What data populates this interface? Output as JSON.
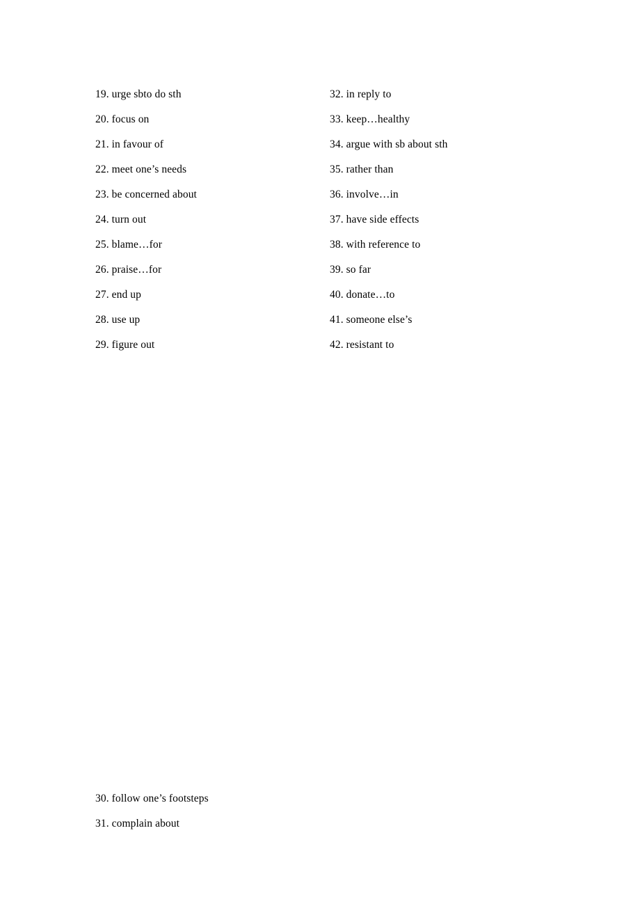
{
  "document": {
    "type": "phrase-list",
    "page_background": "#ffffff",
    "text_color": "#000000"
  },
  "columns": {
    "left": {
      "entries": [
        {
          "number": "19.",
          "text": "urge sbto do sth",
          "full": "19. urge sbto do sth"
        },
        {
          "number": "20.",
          "text": "focus on",
          "full": "20. focus on"
        },
        {
          "number": "21.",
          "text": "in favour of",
          "full": "21. in favour of"
        },
        {
          "number": "22.",
          "text": "meet one’s needs",
          "full": "22. meet one’s needs"
        },
        {
          "number": "23.",
          "text": "be concerned about",
          "full": "23. be concerned about"
        },
        {
          "number": "24.",
          "text": "turn out",
          "full": "24. turn out"
        },
        {
          "number": "25.",
          "text": "blame…for",
          "full": "25. blame…for"
        },
        {
          "number": "26.",
          "text": "praise…for",
          "full": "26. praise…for"
        },
        {
          "number": "27.",
          "text": "end up",
          "full": "27. end up"
        },
        {
          "number": "28.",
          "text": "use up",
          "full": "28. use up"
        },
        {
          "number": "29.",
          "text": "figure out",
          "full": "29. figure out"
        }
      ]
    },
    "right": {
      "entries": [
        {
          "number": "32.",
          "text": "in reply to",
          "full": "32. in reply to"
        },
        {
          "number": "33.",
          "text": "keep…healthy",
          "full": "33. keep…healthy"
        },
        {
          "number": "34.",
          "text": "argue with sb about sth",
          "full": "34. argue with sb about sth"
        },
        {
          "number": "35.",
          "text": "rather than",
          "full": "35. rather than"
        },
        {
          "number": "36.",
          "text": "involve…in",
          "full": "36. involve…in"
        },
        {
          "number": "37.",
          "text": "have side effects",
          "full": "37. have side effects"
        },
        {
          "number": "38.",
          "text": "with reference to",
          "full": "38. with reference to"
        },
        {
          "number": "39.",
          "text": "so far",
          "full": "39. so far"
        },
        {
          "number": "40.",
          "text": "donate…to",
          "full": "40. donate…to"
        },
        {
          "number": "41.",
          "text": "someone else’s",
          "full": "41. someone else’s"
        },
        {
          "number": "42.",
          "text": "resistant to",
          "full": "42. resistant to"
        }
      ]
    }
  },
  "bottom_block": {
    "entries": [
      {
        "number": "30.",
        "text": "follow one’s footsteps",
        "full": "30. follow one’s footsteps"
      },
      {
        "number": "31.",
        "text": "complain about",
        "full": "31. complain about"
      }
    ]
  }
}
